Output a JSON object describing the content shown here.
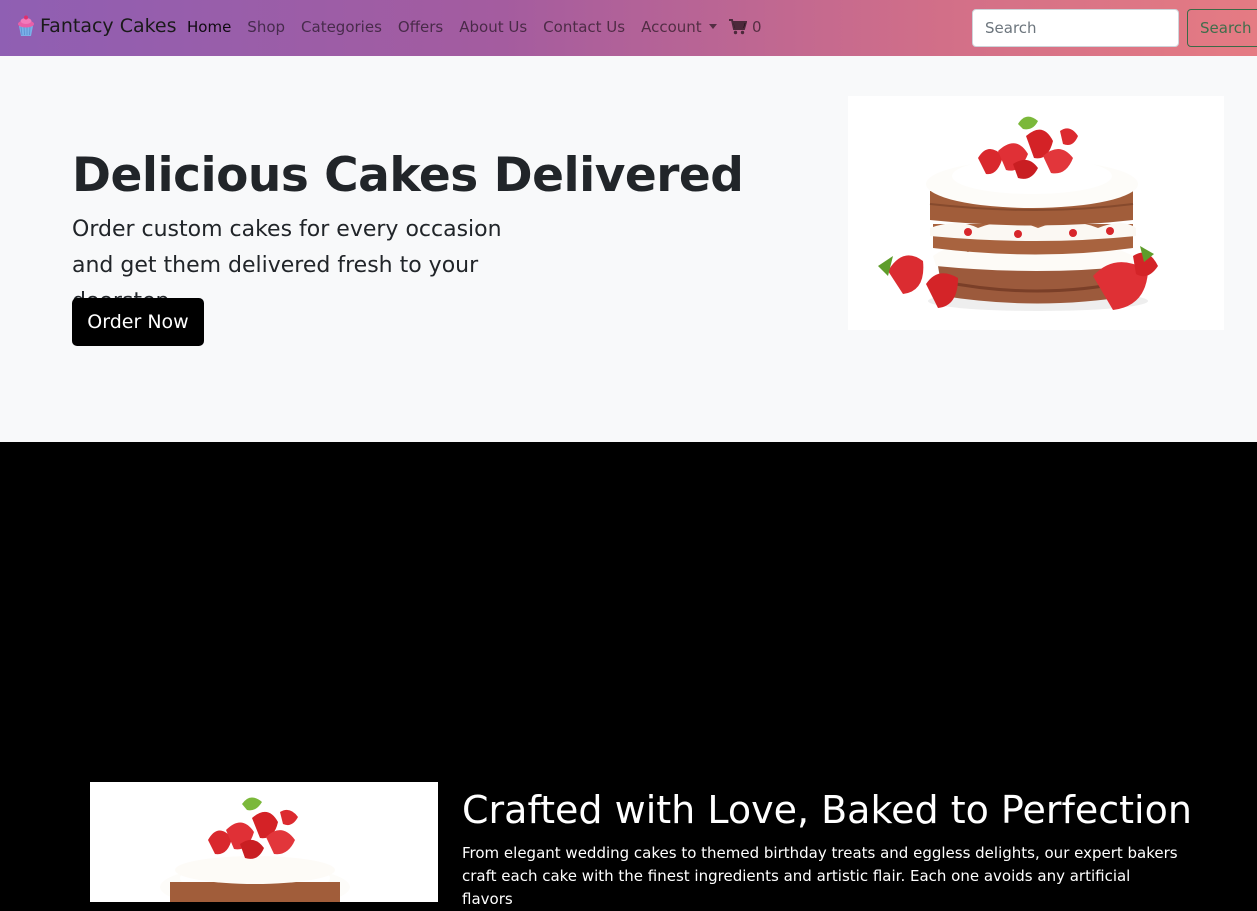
{
  "navbar": {
    "brand": "Fantacy Cakes",
    "links": [
      {
        "label": "Home",
        "active": true
      },
      {
        "label": "Shop"
      },
      {
        "label": "Categories"
      },
      {
        "label": "Offers"
      },
      {
        "label": "About Us"
      },
      {
        "label": "Contact Us"
      }
    ],
    "account_label": "Account",
    "cart_icon": "shopping-cart-icon",
    "cart_count": "0",
    "search_placeholder": "Search",
    "search_button": "Search"
  },
  "hero": {
    "title": "Delicious Cakes Delivered",
    "subtitle": "Order custom cakes for every occasion and get them delivered fresh to your doorstep.",
    "cta": "Order Now"
  },
  "about": {
    "title": "Crafted with Love, Baked to Perfection",
    "text": "From elegant wedding cakes to themed birthday treats and eggless delights, our expert bakers craft each cake with the finest ingredients and artistic flair. Each one avoids any artificial flavors"
  },
  "colors": {
    "nav_gradient_start": "#8f5fb3",
    "nav_gradient_end": "#e57b83",
    "hero_bg": "#f8f9fa",
    "section_bg": "#000000"
  }
}
